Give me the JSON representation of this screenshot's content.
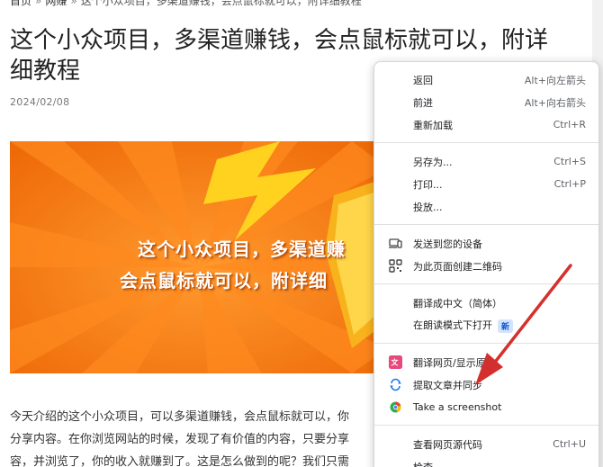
{
  "breadcrumb": {
    "home": "首页",
    "category": "网赚",
    "current": "这个小众项目，多渠道赚钱，会点鼠标就可以，附详细教程"
  },
  "article": {
    "title": "这个小众项目，多渠道赚钱，会点鼠标就可以，附详细教程",
    "date": "2024/02/08",
    "banner_line1": "这个小众项目，多渠道赚",
    "banner_line2": "会点鼠标就可以，附详细",
    "body_line1": "今天介绍的这个小众项目，可以多渠道赚钱，会点鼠标就可以，你",
    "body_line2": "分享内容。在你浏览网站的时候，发现了有价值的内容，只要分享",
    "body_line3": "容，并浏览了，你的收入就赚到了。这是怎么做到的呢？我们只需"
  },
  "colors": {
    "banner_bg": "#f47a14",
    "annotation_arrow": "#e53935",
    "badge_bg": "#d3e3fd",
    "badge_text": "#0b57d0"
  },
  "context_menu": {
    "back": {
      "label": "返回",
      "shortcut": "Alt+向左箭头"
    },
    "forward": {
      "label": "前进",
      "shortcut": "Alt+向右箭头"
    },
    "reload": {
      "label": "重新加载",
      "shortcut": "Ctrl+R"
    },
    "save_as": {
      "label": "另存为...",
      "shortcut": "Ctrl+S"
    },
    "print": {
      "label": "打印...",
      "shortcut": "Ctrl+P"
    },
    "cast": {
      "label": "投放..."
    },
    "send_to_devices": {
      "label": "发送到您的设备",
      "icon": "devices-icon"
    },
    "qr_code": {
      "label": "为此页面创建二维码",
      "icon": "qr-code-icon"
    },
    "translate_chinese": {
      "label": "翻译成中文（简体）"
    },
    "reading_mode": {
      "label": "在朗读模式下打开",
      "badge": "新"
    },
    "translate_page": {
      "label": "翻译网页/显示原文",
      "icon": "translate-icon"
    },
    "extract_article": {
      "label": "提取文章并同步",
      "icon": "sync-icon"
    },
    "screenshot": {
      "label": "Take a screenshot",
      "icon": "screenshot-icon"
    },
    "view_source": {
      "label": "查看网页源代码",
      "shortcut": "Ctrl+U"
    },
    "inspect": {
      "label": "检查"
    }
  }
}
